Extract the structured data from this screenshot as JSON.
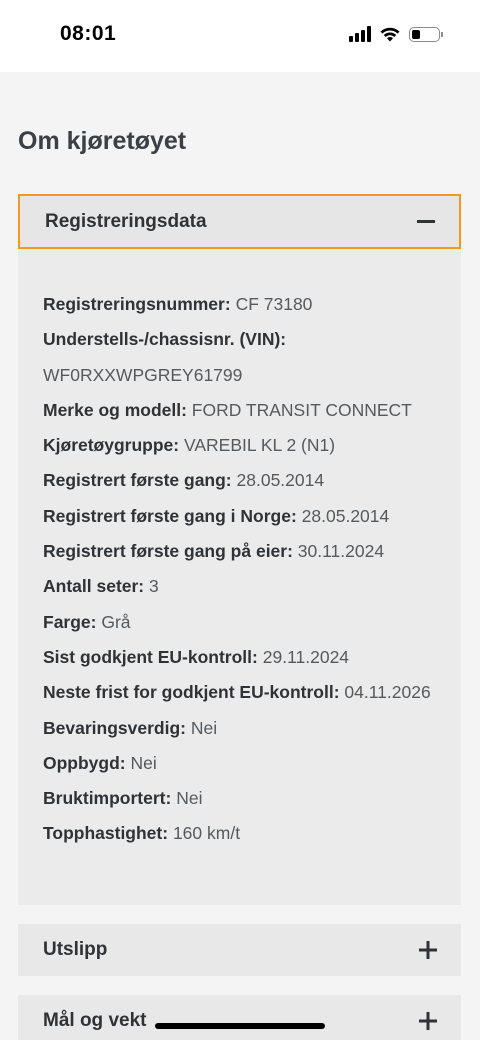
{
  "status_bar": {
    "time": "08:01"
  },
  "page": {
    "title": "Om kjøretøyet"
  },
  "sections": [
    {
      "label": "Registreringsdata",
      "expanded": true,
      "toggle_icon": "minus-icon"
    },
    {
      "label": "Utslipp",
      "expanded": false,
      "toggle_icon": "plus-icon"
    },
    {
      "label": "Mål og vekt",
      "expanded": false,
      "toggle_icon": "plus-icon"
    }
  ],
  "registration": {
    "reg_number": {
      "label": "Registreringsnummer:",
      "value": "CF 73180"
    },
    "vin": {
      "label": "Understells-/chassisnr. (VIN):",
      "value": "WF0RXXWPGREY61799"
    },
    "make_model": {
      "label": "Merke og modell:",
      "value": "FORD TRANSIT CONNECT"
    },
    "vehicle_group": {
      "label": "Kjøretøygruppe:",
      "value": "VAREBIL KL 2 (N1)"
    },
    "first_registered": {
      "label": "Registrert første gang:",
      "value": "28.05.2014"
    },
    "first_registered_norway": {
      "label": "Registrert første gang i Norge:",
      "value": "28.05.2014"
    },
    "first_registered_owner": {
      "label": "Registrert første gang på eier:",
      "value": "30.11.2024"
    },
    "seats": {
      "label": "Antall seter:",
      "value": "3"
    },
    "color": {
      "label": "Farge:",
      "value": "Grå"
    },
    "last_eu_control": {
      "label": "Sist godkjent EU-kontroll:",
      "value": "29.11.2024"
    },
    "next_eu_deadline": {
      "label": "Neste frist for godkjent EU-kontroll:",
      "value": "04.11.2026"
    },
    "preservation_worthy": {
      "label": "Bevaringsverdig:",
      "value": "Nei"
    },
    "rebuilt": {
      "label": "Oppbygd:",
      "value": "Nei"
    },
    "used_import": {
      "label": "Bruktimportert:",
      "value": "Nei"
    },
    "top_speed": {
      "label": "Topphastighet:",
      "value": "160 km/t"
    }
  },
  "colors": {
    "focus_outline": "#f29a1d",
    "panel_bg": "#ebebeb",
    "page_bg": "#f4f4f4"
  }
}
